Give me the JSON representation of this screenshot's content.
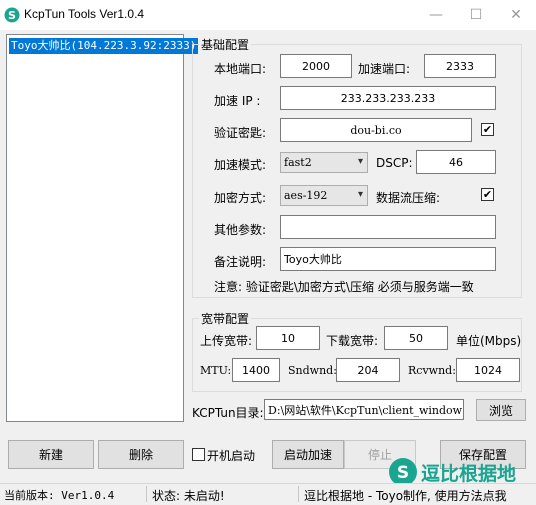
{
  "window": {
    "title": "KcpTun Tools   Ver1.0.4",
    "minimize_icon": "minimize-icon",
    "maximize_icon": "maximize-icon",
    "close_icon": "close-icon"
  },
  "server_list": {
    "items": [
      "Toyo大帅比(104.223.3.92:2333)"
    ]
  },
  "basic": {
    "legend": "基础配置",
    "local_port_label": "本地端口:",
    "local_port_value": "2000",
    "accel_port_label": "加速端口:",
    "accel_port_value": "2333",
    "accel_ip_label": "加速 IP :",
    "accel_ip_value": "233.233.233.233",
    "key_label": "验证密匙:",
    "key_value": "dou-bi.co",
    "key_checked": "✔",
    "mode_label": "加速模式:",
    "mode_value": "fast2",
    "dscp_label": "DSCP:",
    "dscp_value": "46",
    "crypt_label": "加密方式:",
    "crypt_value": "aes-192",
    "compress_label": "数据流压缩:",
    "compress_checked": "✔",
    "other_label": "其他参数:",
    "other_value": "",
    "remark_label": "备注说明:",
    "remark_value": "Toyo大帅比",
    "note": "注意: 验证密匙\\加密方式\\压缩 必须与服务端一致"
  },
  "bandwidth": {
    "legend": "宽带配置",
    "up_label": "上传宽带:",
    "up_value": "10",
    "down_label": "下载宽带:",
    "down_value": "50",
    "unit_label": "单位(Mbps)",
    "mtu_label": "MTU:",
    "mtu_value": "1400",
    "sndwnd_label": "Sndwnd:",
    "sndwnd_value": "204",
    "rcvwnd_label": "Rcvwnd:",
    "rcvwnd_value": "1024"
  },
  "dir": {
    "label": "KCPTun目录:",
    "value": "D:\\网站\\软件\\KcpTun\\client_window",
    "browse": "浏览"
  },
  "buttons": {
    "new": "新建",
    "delete": "删除",
    "autostart": "开机启动",
    "start": "启动加速",
    "stop": "停止",
    "save": "保存配置"
  },
  "watermark": "逗比根据地",
  "status": {
    "version": "当前版本: Ver1.0.4",
    "state": "状态: 未启动!",
    "credit": "逗比根据地 - Toyo制作, 使用方法点我"
  },
  "colors": {
    "selection": "#0078d7",
    "logo": "#1aa591"
  }
}
